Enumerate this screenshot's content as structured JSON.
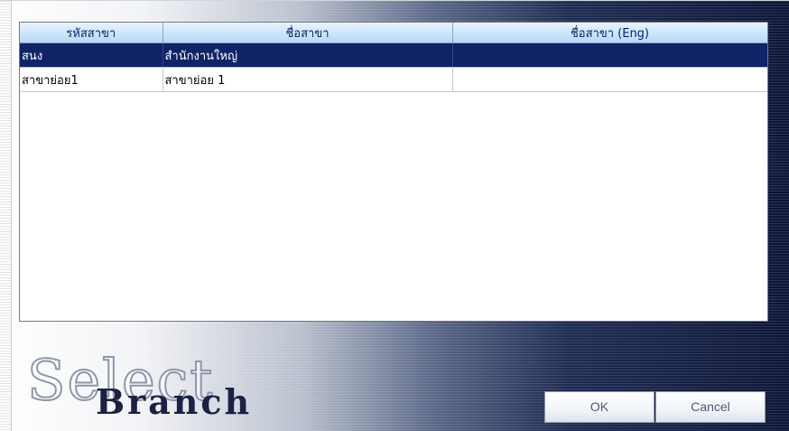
{
  "grid": {
    "columns": [
      "รหัสสาขา",
      "ชื่อสาขา",
      "ชื่อสาขา (Eng)"
    ],
    "rows": [
      {
        "code": "สนง",
        "name": "สำนักงานใหญ่",
        "name_eng": "",
        "selected": true
      },
      {
        "code": "สาขาย่อย1",
        "name": "สาขาย่อย 1",
        "name_eng": "",
        "selected": false
      }
    ]
  },
  "logo": {
    "line1": "Select",
    "line2": "Branch"
  },
  "buttons": {
    "ok_label": "OK",
    "cancel_label": "Cancel"
  },
  "colors": {
    "selected_row": "#0f2466",
    "header_fill": "#b6d9f7",
    "header_text": "#0b1d6a"
  }
}
